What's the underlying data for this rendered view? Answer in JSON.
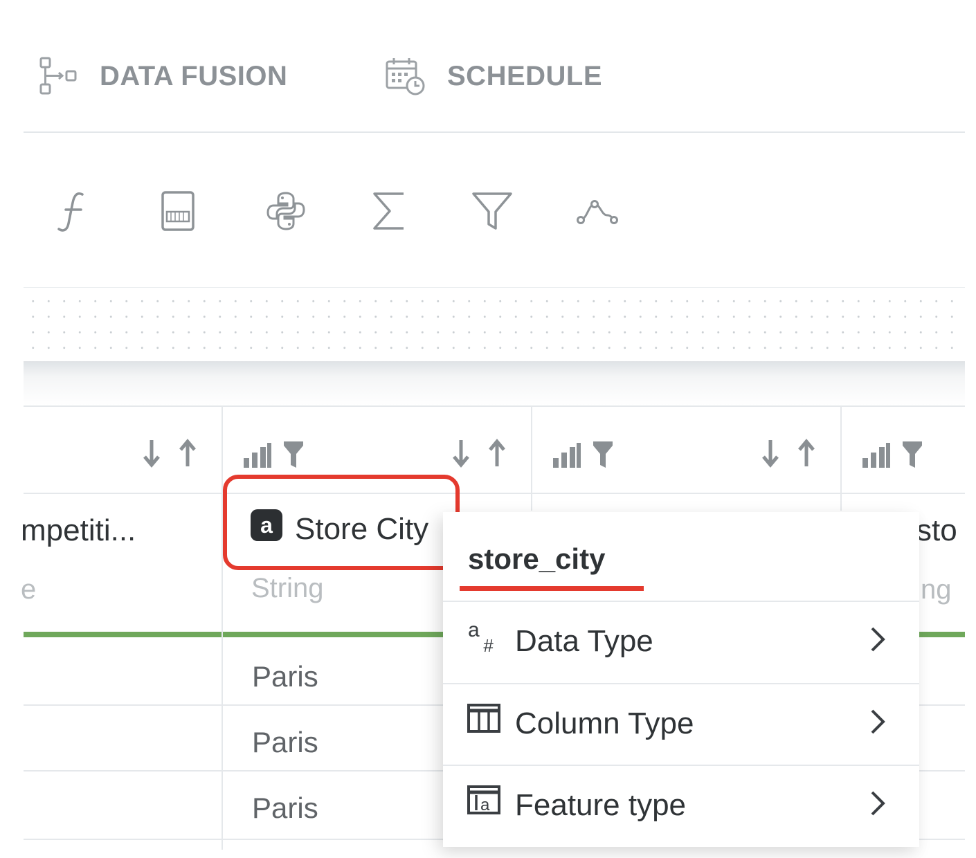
{
  "tabs": [
    {
      "label": "DATA FUSION",
      "icon": "data-fusion-icon"
    },
    {
      "label": "SCHEDULE",
      "icon": "calendar-schedule-icon"
    }
  ],
  "toolbar": [
    {
      "icon": "function-icon"
    },
    {
      "icon": "calculator-icon"
    },
    {
      "icon": "python-icon"
    },
    {
      "icon": "sigma-icon"
    },
    {
      "icon": "filter-icon"
    },
    {
      "icon": "curve-icon"
    }
  ],
  "columns": [
    {
      "title": "mpetiti...",
      "type": "e"
    },
    {
      "title": "Store City",
      "type": "String",
      "badge": "a",
      "values": [
        "Paris",
        "Paris",
        "Paris"
      ]
    },
    {
      "title": "",
      "type": ""
    },
    {
      "title": "sto",
      "type": "ng"
    }
  ],
  "context_menu": {
    "title": "store_city",
    "items": [
      {
        "label": "Data Type",
        "icon": "data-type-icon"
      },
      {
        "label": "Column Type",
        "icon": "column-type-icon"
      },
      {
        "label": "Feature type",
        "icon": "feature-type-icon"
      }
    ]
  },
  "colors": {
    "accent_red": "#e43a2e",
    "status_green": "#6fa85b",
    "muted_text": "#8c9196"
  }
}
